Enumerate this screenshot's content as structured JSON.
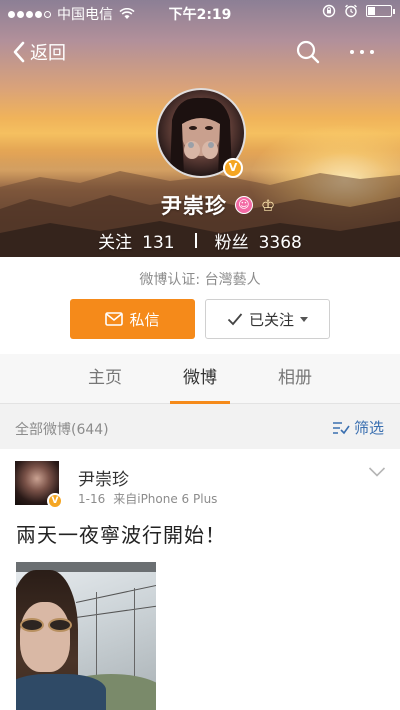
{
  "status_bar": {
    "carrier": "中国电信",
    "time": "下午2:19"
  },
  "nav": {
    "back_label": "返回"
  },
  "profile": {
    "name": "尹崇珍",
    "following_label": "关注",
    "following_count": "131",
    "followers_label": "粉丝",
    "followers_count": "3368",
    "verified_text": "微博认证: 台灣藝人",
    "message_button": "私信",
    "follow_button": "已关注",
    "verified_badge": "V"
  },
  "tabs": [
    {
      "label": "主页",
      "active": false
    },
    {
      "label": "微博",
      "active": true
    },
    {
      "label": "相册",
      "active": false
    }
  ],
  "filter_bar": {
    "all_posts": "全部微博(644)",
    "filter_label": "筛选"
  },
  "post": {
    "author": "尹崇珍",
    "date": "1-16",
    "source": "来自iPhone 6 Plus",
    "text": "兩天一夜寧波行開始！"
  },
  "colors": {
    "accent_orange": "#f58a1a",
    "verified_yellow": "#f5a623",
    "link_blue": "#3a6fb0",
    "member_pink": "#f36ba5"
  },
  "icons": [
    "back-chevron-icon",
    "search-icon",
    "more-dots-icon",
    "mail-icon",
    "check-icon",
    "filter-icon",
    "chevron-down-icon",
    "crown-icon",
    "member-icon"
  ]
}
